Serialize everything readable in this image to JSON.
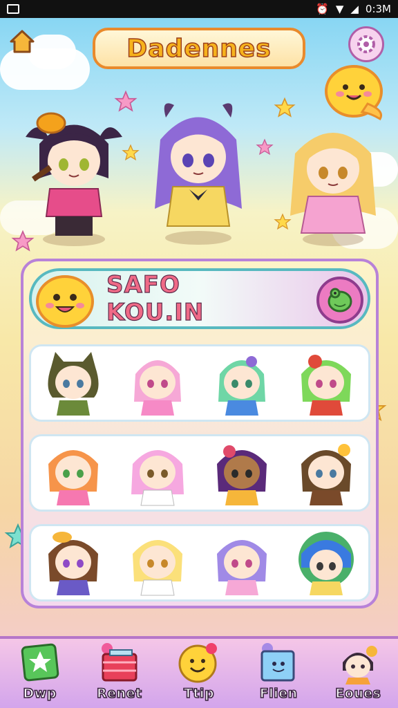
{
  "status_bar": {
    "time": "0:3M"
  },
  "header": {
    "title": "Dadennes"
  },
  "panel": {
    "title": "SAFO KOU.IN"
  },
  "rows": [
    {
      "items": [
        "char-1",
        "char-2",
        "char-3",
        "char-4"
      ]
    },
    {
      "items": [
        "char-5",
        "char-6",
        "char-7",
        "char-8"
      ]
    },
    {
      "items": [
        "char-9",
        "char-10",
        "char-11",
        "char-12"
      ]
    }
  ],
  "nav": [
    {
      "label": "Dwp",
      "icon": "star-card-icon"
    },
    {
      "label": "Renet",
      "icon": "gift-box-icon"
    },
    {
      "label": "Ttip",
      "icon": "smiley-balloon-icon"
    },
    {
      "label": "Flien",
      "icon": "photo-frame-icon"
    },
    {
      "label": "Eoues",
      "icon": "character-icon"
    }
  ],
  "colors": {
    "accent": "#e98a2c",
    "panel_border": "#b882d8",
    "header_border": "#58b9c0",
    "nav_bg": "#d3a5ec"
  }
}
